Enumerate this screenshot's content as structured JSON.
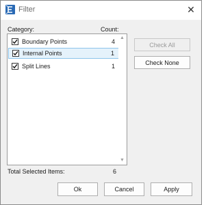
{
  "window": {
    "title": "Filter",
    "close_glyph": "✕"
  },
  "list": {
    "category_header": "Category:",
    "count_header": "Count:",
    "items": [
      {
        "label": "Boundary Points",
        "count": "4",
        "checked": true,
        "selected": false
      },
      {
        "label": "Internal Points",
        "count": "1",
        "checked": true,
        "selected": true
      },
      {
        "label": "Split Lines",
        "count": "1",
        "checked": true,
        "selected": false
      }
    ],
    "scroll_up_glyph": "▲",
    "scroll_down_glyph": "▼"
  },
  "side_buttons": {
    "check_all": "Check All",
    "check_none": "Check None"
  },
  "footer": {
    "total_label": "Total Selected Items:",
    "total_value": "6"
  },
  "buttons": {
    "ok": "Ok",
    "cancel": "Cancel",
    "apply": "Apply"
  },
  "colors": {
    "selection_fill": "#e5f2fb",
    "selection_border": "#8cc3ea",
    "app_icon": "#2a6ab5"
  },
  "icons": {
    "app": "filter-app-icon",
    "close": "close-icon",
    "check": "checkmark-icon"
  }
}
